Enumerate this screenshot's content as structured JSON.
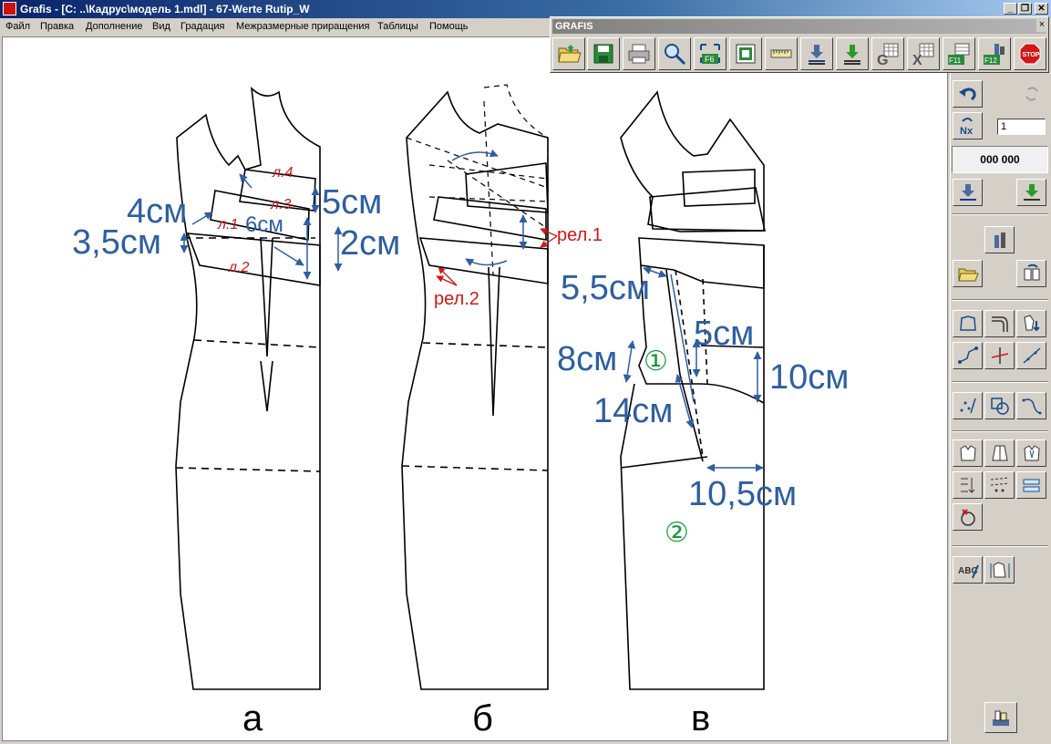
{
  "window": {
    "title": "Grafis - [C: ..\\Кадрус\\модель 1.mdl] - 67-Werte Rutip_W",
    "min_label": "_",
    "restore_label": "❐",
    "close_label": "✕"
  },
  "menu": {
    "items": [
      "Файл",
      "Правка",
      "Дополнение",
      "Вид",
      "Градация",
      "Межразмерные приращения",
      "Таблицы",
      "Помощь"
    ]
  },
  "floating_toolbar": {
    "title": "GRAFIS",
    "close_label": "×",
    "buttons": [
      "open-folder-icon",
      "save-icon",
      "print-icon",
      "zoom-icon",
      "f6-fit-icon",
      "frame-icon",
      "ruler-icon",
      "download-icon",
      "import-icon",
      "grafis-g-icon",
      "excel-icon",
      "f11-icon",
      "f12-icon",
      "stop-icon"
    ],
    "labels": {
      "f6": "F6",
      "f11": "F11",
      "f12": "F12",
      "stop": "STOP",
      "g": "G",
      "x": "X"
    }
  },
  "side_panel": {
    "counter_value": "1",
    "nx_label": "Nx",
    "coordinate_display": "000 000"
  },
  "drawing": {
    "figure_labels": [
      "а",
      "б",
      "в"
    ],
    "fig_a": {
      "dims": [
        "4см",
        "3,5см",
        "5см",
        "6см",
        "2см"
      ],
      "piece_labels": [
        "л.4",
        "л.3",
        "л.1",
        "л.2"
      ]
    },
    "fig_b": {
      "relief_labels": [
        "рел.1",
        "рел.2"
      ]
    },
    "fig_c": {
      "dims": [
        "5,5см",
        "5см",
        "8см",
        "10см",
        "14см",
        "10,5см"
      ],
      "part_numbers": [
        "①",
        "②"
      ]
    }
  },
  "colors": {
    "dim_blue": "#2e5fa0",
    "label_red": "#d01818",
    "part_green": "#1a9a3a"
  }
}
